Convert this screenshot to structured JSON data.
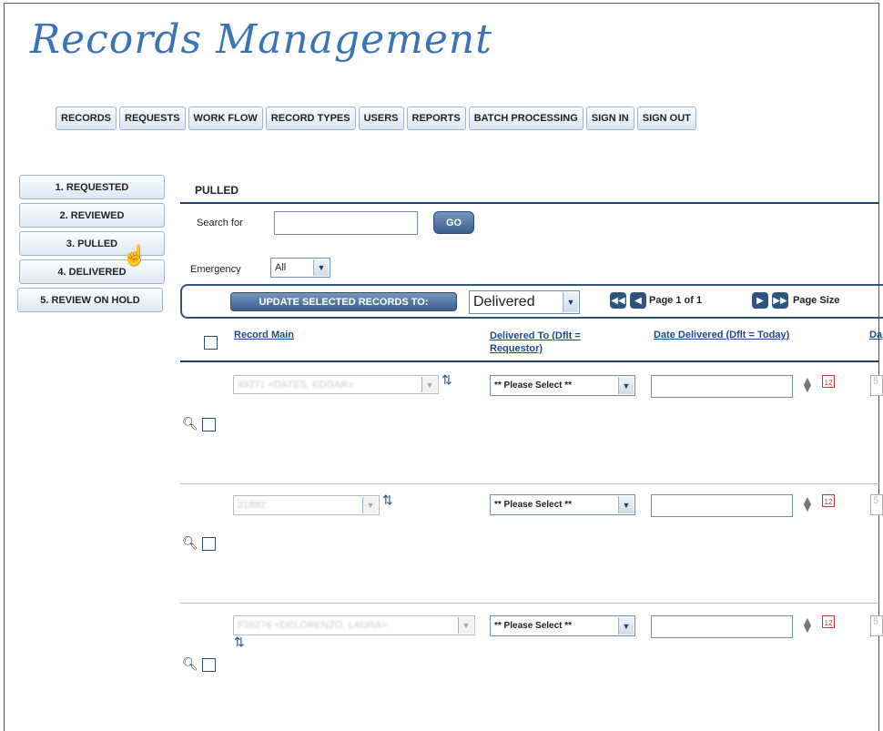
{
  "app": {
    "title": "Records Management"
  },
  "topnav": [
    "RECORDS",
    "REQUESTS",
    "WORK FLOW",
    "RECORD TYPES",
    "USERS",
    "REPORTS",
    "BATCH PROCESSING",
    "SIGN IN",
    "SIGN OUT"
  ],
  "sidenav": [
    "1. REQUESTED",
    "2. REVIEWED",
    "3. PULLED",
    "4. DELIVERED",
    "5. REVIEW ON HOLD"
  ],
  "page": {
    "section_title": "PULLED",
    "search_label": "Search for",
    "search_value": "",
    "go_label": "GO",
    "emergency_label": "Emergency",
    "emergency_value": "All"
  },
  "toolbar": {
    "update_label": "UPDATE SELECTED RECORDS TO:",
    "status_value": "Delivered",
    "page_text": "Page 1 of 1",
    "page_size_label": "Page Size"
  },
  "columns": {
    "record_main": "Record Main",
    "delivered_to": "Delivered To (Dflt = Requestor)",
    "date_delivered": "Date Delivered (Dflt = Today)",
    "next_col": "Da"
  },
  "rows": [
    {
      "record": "49271 <DATES, EDGAR>",
      "delivered_to": "** Please Select **",
      "date": "",
      "trailing": "5"
    },
    {
      "record": "31892",
      "delivered_to": "** Please Select **",
      "date": "",
      "trailing": "5"
    },
    {
      "record": "F26276 <DELORENZO, LAURA>",
      "delivered_to": "** Please Select **",
      "date": "",
      "trailing": "5"
    }
  ],
  "calendar_day": "12",
  "colors": {
    "title": "#3a73b6",
    "nav_border": "#9fb3c8",
    "accent": "#2e5582"
  }
}
